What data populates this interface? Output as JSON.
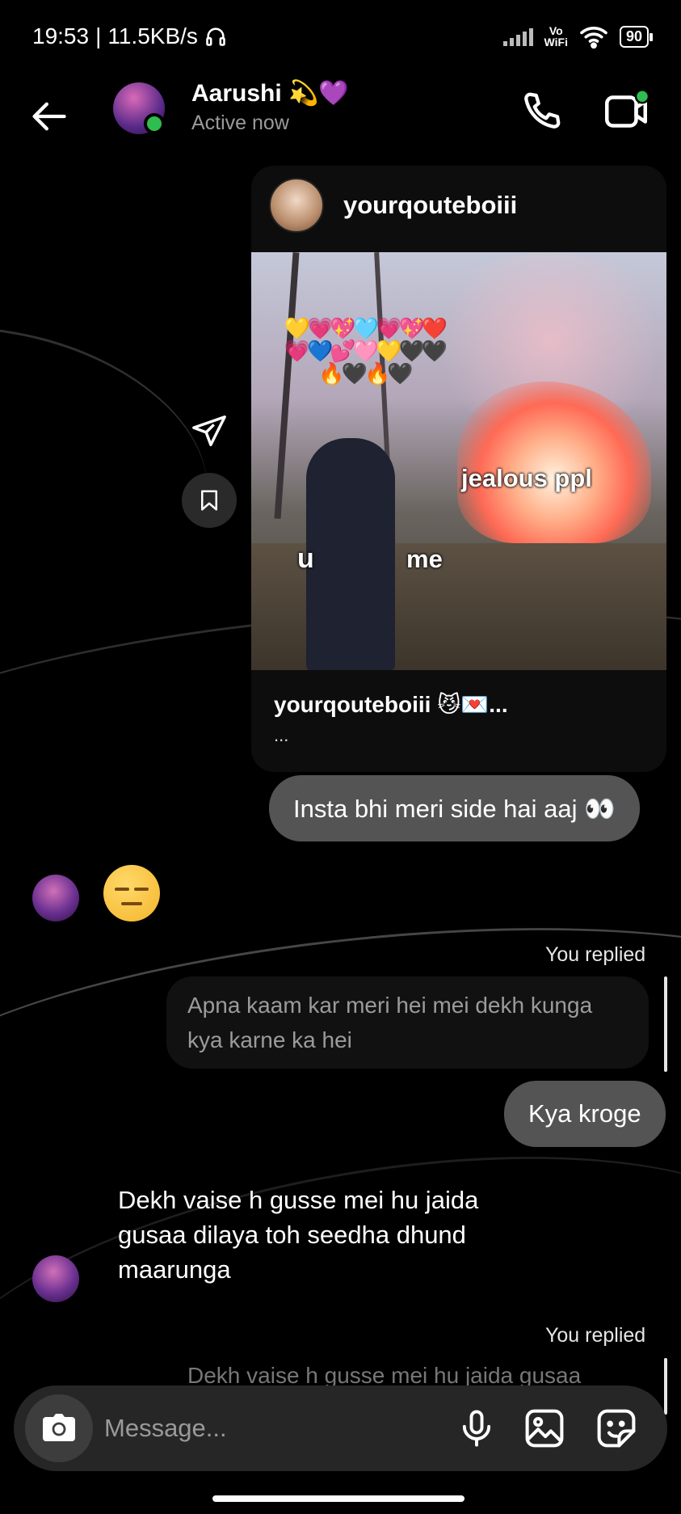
{
  "status_bar": {
    "time": "19:53",
    "net_speed": "11.5KB/s",
    "vowifi_top": "Vo",
    "vowifi_bottom": "WiFi",
    "battery": "90"
  },
  "header": {
    "contact_name": "Aarushi 💫💜",
    "contact_status": "Active now",
    "icons": {
      "back": "back-arrow-icon",
      "call": "phone-icon",
      "video": "video-call-icon"
    }
  },
  "shared_post": {
    "author": "yourqouteboiii",
    "meme_labels": {
      "jealous": "jealous ppl",
      "u": "u",
      "me": "me"
    },
    "hearts": "💛💗💖🩵💗💖❤️💗💙💕🩷💛🖤🖤🔥🖤🔥🖤",
    "caption": "yourqouteboiii 😼💌...",
    "caption_more": "..."
  },
  "messages": {
    "m1_out": "Insta bhi meri side hai aaj 👀",
    "you_replied_1": "You replied",
    "reply_quote_1": "Apna kaam kar meri hei mei dekh kunga kya karne ka hei",
    "m2_out": "Kya kroge",
    "m3_in": "Dekh vaise h gusse mei hu jaida gusaa dilaya toh seedha dhund maarunga",
    "you_replied_2": "You replied",
    "reply_quote_2": "Dekh vaise h gusse mei hu jaida gusaa"
  },
  "composer": {
    "placeholder": "Message..."
  },
  "colors": {
    "online": "#2ebd4e",
    "bubble_out": "#545454",
    "composer_bg": "#262626"
  }
}
